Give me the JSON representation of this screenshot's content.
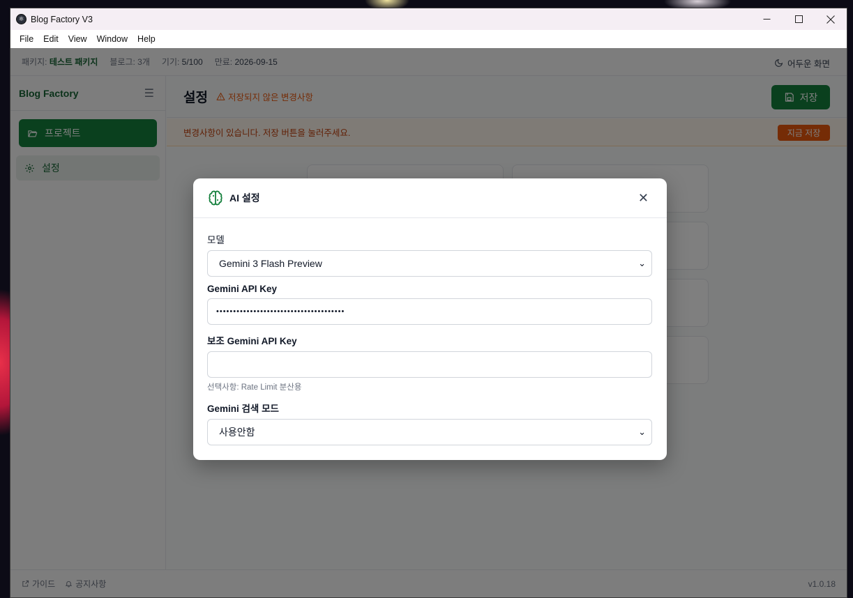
{
  "window": {
    "title": "Blog Factory V3"
  },
  "menu": [
    "File",
    "Edit",
    "View",
    "Window",
    "Help"
  ],
  "infobar": {
    "package_label": "패키지:",
    "package_value": "테스트 패키지",
    "blog": "블로그: 3개",
    "device_label": "기기:",
    "device_value": "5/100",
    "expiry_label": "만료:",
    "expiry_value": "2026-09-15",
    "dark_mode": "어두운 화면"
  },
  "sidebar": {
    "brand": "Blog Factory",
    "items": [
      {
        "label": "프로젝트",
        "icon": "folder-open-icon"
      },
      {
        "label": "설정",
        "icon": "gear-icon"
      }
    ]
  },
  "main": {
    "title": "설정",
    "unsaved_warning": "저장되지 않은 변경사항",
    "save_button": "저장",
    "notice_text": "변경사항이 있습니다. 저장 버튼을 눌러주세요.",
    "notice_button": "지금 저장"
  },
  "footer": {
    "guide": "가이드",
    "notice": "공지사항",
    "version": "v1.0.18"
  },
  "modal": {
    "title": "AI 설정",
    "model_label": "모델",
    "model_value": "Gemini 3 Flash Preview",
    "api_key_label": "Gemini API Key",
    "api_key_value": "••••••••••••••••••••••••••••••••••••••",
    "secondary_key_label": "보조 Gemini API Key",
    "secondary_key_value": "",
    "secondary_key_hint": "선택사항: Rate Limit 분산용",
    "search_mode_label": "Gemini 검색 모드",
    "search_mode_value": "사용안함"
  },
  "colors": {
    "accent": "#15803d",
    "warning": "#ea580c"
  }
}
